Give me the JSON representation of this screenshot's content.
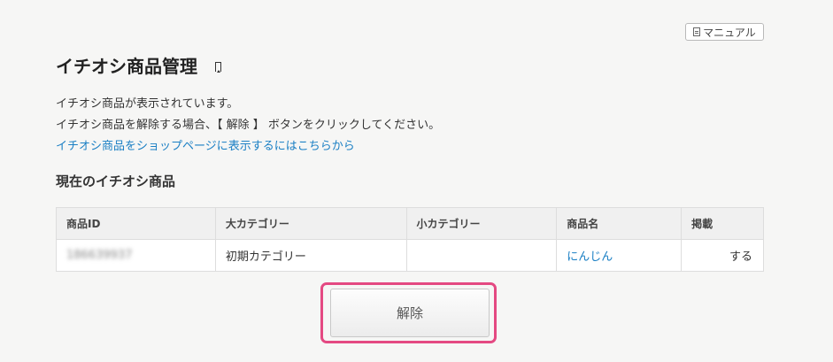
{
  "manual_label": "マニュアル",
  "page_title": "イチオシ商品管理",
  "description": {
    "line1": "イチオシ商品が表示されています。",
    "line2": "イチオシ商品を解除する場合、【 解除 】 ボタンをクリックしてください。",
    "link": "イチオシ商品をショップページに表示するにはこちらから"
  },
  "section_title": "現在のイチオシ商品",
  "table": {
    "headers": [
      "商品ID",
      "大カテゴリー",
      "小カテゴリー",
      "商品名",
      "掲載"
    ],
    "rows": [
      {
        "id": "186639937",
        "category_large": "初期カテゴリー",
        "category_small": "",
        "name": "にんじん",
        "published": "する"
      }
    ]
  },
  "release_button": "解除",
  "colors": {
    "link": "#1a7fc4",
    "highlight": "#e44982"
  }
}
